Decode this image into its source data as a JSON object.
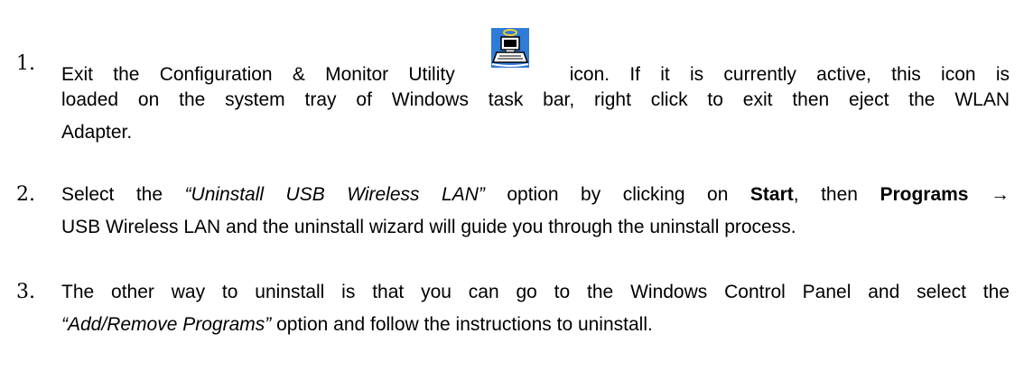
{
  "instructions": [
    {
      "number": "1.",
      "before_icon": "Exit the Configuration & Monitor Utility",
      "after_icon": "icon. If it is currently active, this icon is",
      "line2": "loaded on the system tray of Windows task bar, right click to exit then eject the WLAN",
      "line3": "Adapter.",
      "icon": "wlan-utility-computer-icon"
    },
    {
      "number": "2.",
      "seg1": "Select the ",
      "seg2_italic": "“Uninstall USB Wireless LAN”",
      "seg3": " option by clicking on ",
      "seg4_bold": "Start",
      "seg5": ", then ",
      "seg6_bold": "Programs",
      "arrow": "→",
      "line2": "USB Wireless LAN and the uninstall wizard will guide you through the uninstall process."
    },
    {
      "number": "3.",
      "line1": "The other way to uninstall is that you can go to the Windows Control Panel and select the",
      "seg2_italic": "“Add/Remove Programs”",
      "seg3": " option and follow the instructions to uninstall."
    }
  ],
  "colors": {
    "icon_bg": "#2f7bd8",
    "icon_halo": "#f2d02a"
  }
}
